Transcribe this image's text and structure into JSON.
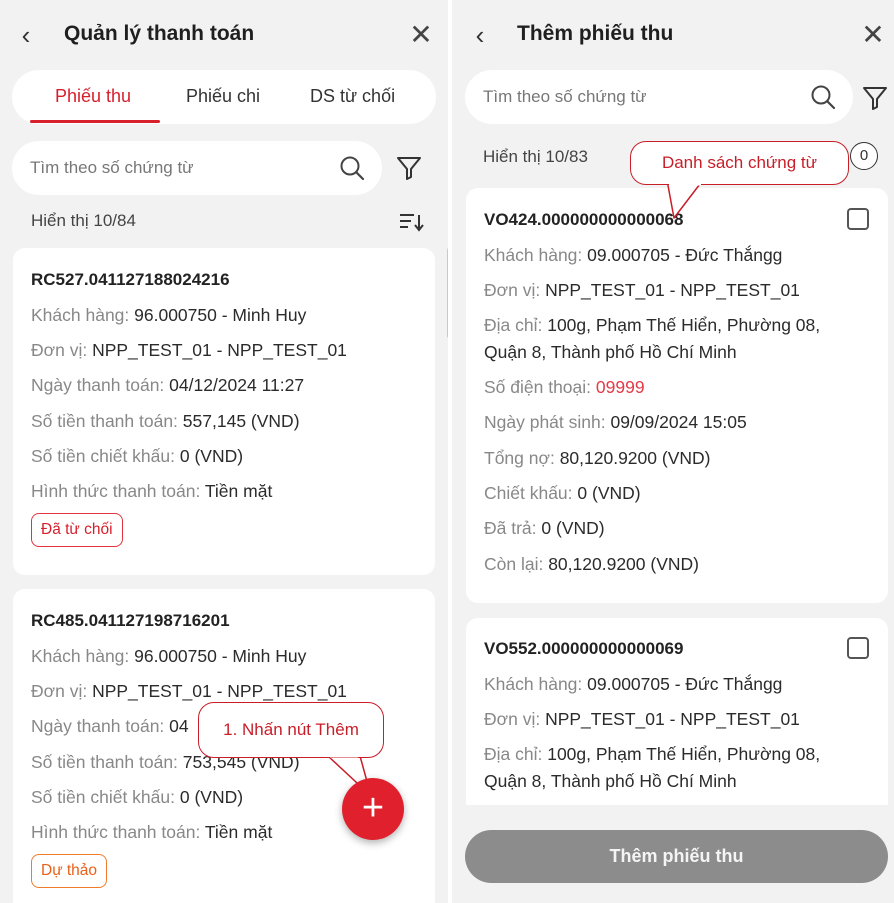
{
  "left": {
    "header": {
      "title": "Quản lý thanh toán"
    },
    "tabs": [
      {
        "label": "Phiếu thu"
      },
      {
        "label": "Phiếu chi"
      },
      {
        "label": "DS từ chối"
      }
    ],
    "search": {
      "placeholder": "Tìm theo số chứng từ"
    },
    "count_text": "Hiển thị 10/84",
    "cards": [
      {
        "code": "RC527.041127188024216",
        "rows": [
          {
            "label": "Khách hàng: ",
            "value": "96.000750 - Minh Huy"
          },
          {
            "label": "Đơn vị: ",
            "value": "NPP_TEST_01 - NPP_TEST_01"
          },
          {
            "label": "Ngày thanh toán: ",
            "value": "04/12/2024 11:27"
          },
          {
            "label": "Số tiền thanh toán: ",
            "value": "557,145 (VND)"
          },
          {
            "label": "Số tiền chiết khấu: ",
            "value": "0 (VND)"
          },
          {
            "label": "Hình thức thanh toán: ",
            "value": "Tiền mặt"
          }
        ],
        "badge": "Đã từ chối"
      },
      {
        "code": "RC485.041127198716201",
        "rows": [
          {
            "label": "Khách hàng: ",
            "value": "96.000750 - Minh Huy"
          },
          {
            "label": "Đơn vị: ",
            "value": "NPP_TEST_01 - NPP_TEST_01"
          },
          {
            "label": "Ngày thanh toán: ",
            "value": "04"
          },
          {
            "label": "Số tiền thanh toán: ",
            "value": "753,545 (VND)"
          },
          {
            "label": "Số tiền chiết khấu: ",
            "value": "0 (VND)"
          },
          {
            "label": "Hình thức thanh toán: ",
            "value": "Tiền mặt"
          }
        ],
        "badge": "Dự thảo"
      }
    ],
    "annotation": "1. Nhấn nút Thêm"
  },
  "right": {
    "header": {
      "title": "Thêm phiếu thu"
    },
    "search": {
      "placeholder": "Tìm theo số chứng từ"
    },
    "count_text": "Hiển thị 10/83",
    "selected_count": "0",
    "annotation": "Danh sách chứng từ",
    "cards": [
      {
        "code": "VO424.000000000000068",
        "rows": [
          {
            "label": "Khách hàng: ",
            "value": "09.000705 - Đức Thắngg"
          },
          {
            "label": "Đơn vị: ",
            "value": "NPP_TEST_01 - NPP_TEST_01"
          },
          {
            "label": "Địa chỉ: ",
            "value": "100g, Phạm Thế Hiển, Phường 08,"
          },
          {
            "label": "",
            "value": "Quận 8, Thành phố Hồ Chí Minh"
          },
          {
            "label": "Số điện thoại: ",
            "value": "09999"
          },
          {
            "label": "Ngày phát sinh: ",
            "value": "09/09/2024 15:05"
          },
          {
            "label": "Tổng nợ: ",
            "value": "80,120.9200 (VND)"
          },
          {
            "label": "Chiết khấu: ",
            "value": "0 (VND)"
          },
          {
            "label": "Đã trả: ",
            "value": "0 (VND)"
          },
          {
            "label": "Còn lại: ",
            "value": "80,120.9200 (VND)"
          }
        ]
      },
      {
        "code": "VO552.000000000000069",
        "rows": [
          {
            "label": "Khách hàng: ",
            "value": "09.000705 - Đức Thắngg"
          },
          {
            "label": "Đơn vị: ",
            "value": "NPP_TEST_01 - NPP_TEST_01"
          },
          {
            "label": "Địa chỉ: ",
            "value": "100g, Phạm Thế Hiển, Phường 08,"
          },
          {
            "label": "",
            "value": "Quận 8, Thành phố Hồ Chí Minh"
          }
        ]
      }
    ],
    "submit_label": "Thêm phiếu thu"
  },
  "colors": {
    "accent": "#d8202c",
    "background": "#f2f2f2",
    "disabled_button": "#8c8c8c"
  }
}
